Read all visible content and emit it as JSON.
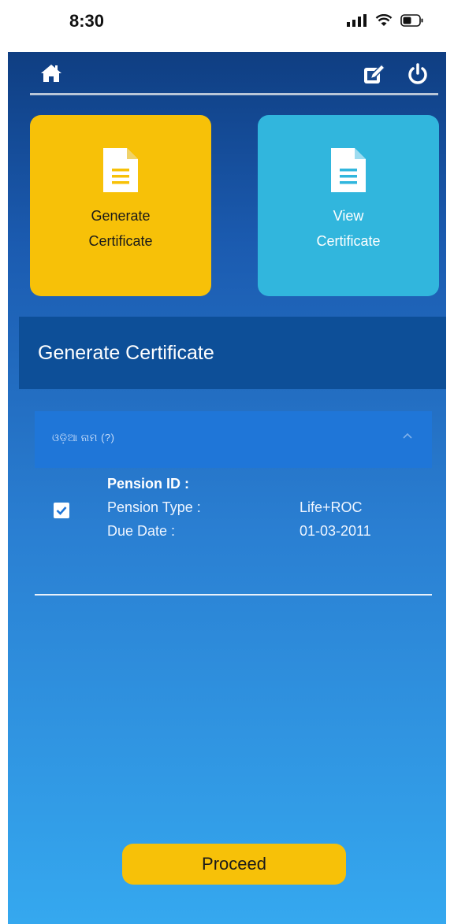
{
  "status": {
    "time": "8:30"
  },
  "tiles": {
    "generate": {
      "line1": "Generate",
      "line2": "Certificate"
    },
    "view": {
      "line1": "View",
      "line2": "Certificate"
    }
  },
  "section": {
    "title": "Generate Certificate"
  },
  "accordion": {
    "title": "ଓଡ଼ିଆ ନାମ (?)"
  },
  "record": {
    "pension_id_label": "Pension ID :",
    "pension_type_label": "Pension Type :",
    "pension_type_value": "Life+ROC",
    "due_date_label": "Due Date :",
    "due_date_value": "01-03-2011",
    "checked": true
  },
  "actions": {
    "proceed": "Proceed"
  },
  "colors": {
    "accent_yellow": "#f7c108",
    "accent_cyan": "#31b6dd",
    "header_blue": "#0d4f98"
  }
}
